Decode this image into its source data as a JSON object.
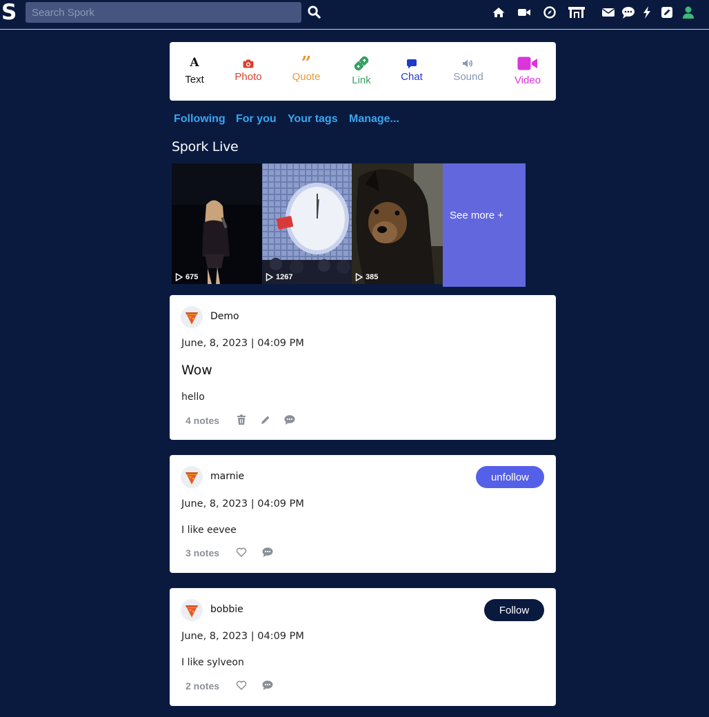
{
  "brand": {
    "logo": "S"
  },
  "search": {
    "placeholder": "Search Spork"
  },
  "nav_icons": [
    "home-icon",
    "video-camera-icon",
    "compass-icon",
    "shop-icon",
    "mail-icon",
    "chat-bubble-icon",
    "lightning-icon",
    "edit-icon",
    "user-icon"
  ],
  "composer": {
    "types": [
      {
        "label": "Text",
        "color": "#111111"
      },
      {
        "label": "Photo",
        "color": "#d9432f"
      },
      {
        "label": "Quote",
        "color": "#e69a3a"
      },
      {
        "label": "Link",
        "color": "#3a9f62"
      },
      {
        "label": "Chat",
        "color": "#1f3ac8"
      },
      {
        "label": "Sound",
        "color": "#8a96b8"
      },
      {
        "label": "Video",
        "color": "#d935d9"
      }
    ]
  },
  "tabs": [
    "Following",
    "For you",
    "Your tags",
    "Manage..."
  ],
  "live": {
    "title": "Spork Live",
    "tiles": [
      {
        "views": "675"
      },
      {
        "views": "1267"
      },
      {
        "views": "385"
      }
    ],
    "see_more": "See more +"
  },
  "posts": [
    {
      "user": "Demo",
      "date": "June, 8, 2023 | 04:09 PM",
      "title": "Wow",
      "body": "hello",
      "notes": "4 notes",
      "actions": [
        "trash-icon",
        "pencil-icon",
        "comment-icon"
      ]
    },
    {
      "user": "marnie",
      "date": "June, 8, 2023 | 04:09 PM",
      "body": "I like eevee",
      "notes": "3 notes",
      "follow_button": "unfollow",
      "actions": [
        "heart-icon",
        "comment-icon"
      ]
    },
    {
      "user": "bobbie",
      "date": "June, 8, 2023 | 04:09 PM",
      "body": "I like sylveon",
      "notes": "2 notes",
      "follow_button": "Follow",
      "actions": [
        "heart-icon",
        "comment-icon"
      ]
    }
  ],
  "colors": {
    "background": "#0a1a3f",
    "accent": "#5560e8",
    "tab_link": "#3aa6f0",
    "see_more": "#6367dd"
  }
}
